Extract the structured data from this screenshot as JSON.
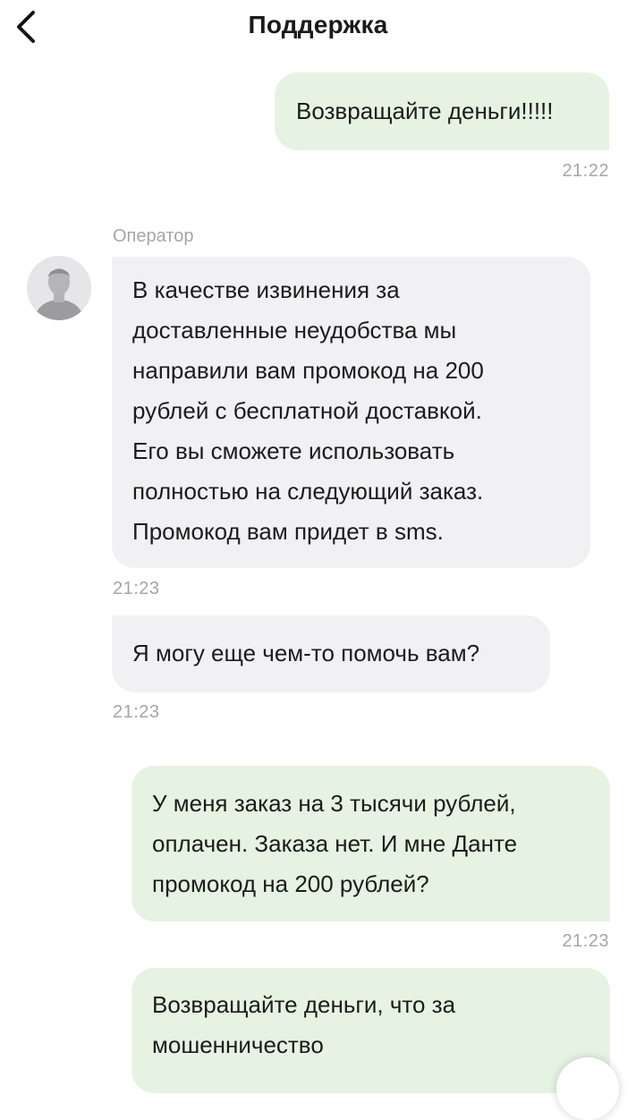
{
  "header": {
    "title": "Поддержка",
    "back_icon": "chevron-left-icon"
  },
  "operator": {
    "name": "Оператор",
    "avatar_icon": "person-placeholder-icon"
  },
  "messages": [
    {
      "from": "user",
      "text": "Возвращайте деньги!!!!!",
      "time": "21:22"
    },
    {
      "from": "operator",
      "text": "В качестве извинения за\nдоставленные неудобства мы\nнаправили вам промокод на 200\nрублей с бесплатной доставкой.\nЕго вы сможете использовать\nполностью на следующий заказ.\nПромокод вам придет в sms.",
      "time": "21:23"
    },
    {
      "from": "operator",
      "text": "Я могу еще чем-то помочь вам?",
      "time": "21:23"
    },
    {
      "from": "user",
      "text": "У меня заказ на 3 тысячи рублей,\nоплачен. Заказа нет. И мне Данте\nпромокод на 200 рублей?",
      "time": "21:23"
    },
    {
      "from": "user",
      "text": "Возвращайте деньги, что за\nмошенничество",
      "time": ""
    }
  ],
  "colors": {
    "outgoing_bubble": "#e6f3e2",
    "incoming_bubble": "#f1f1f3",
    "timestamp": "#a5a5aa"
  }
}
